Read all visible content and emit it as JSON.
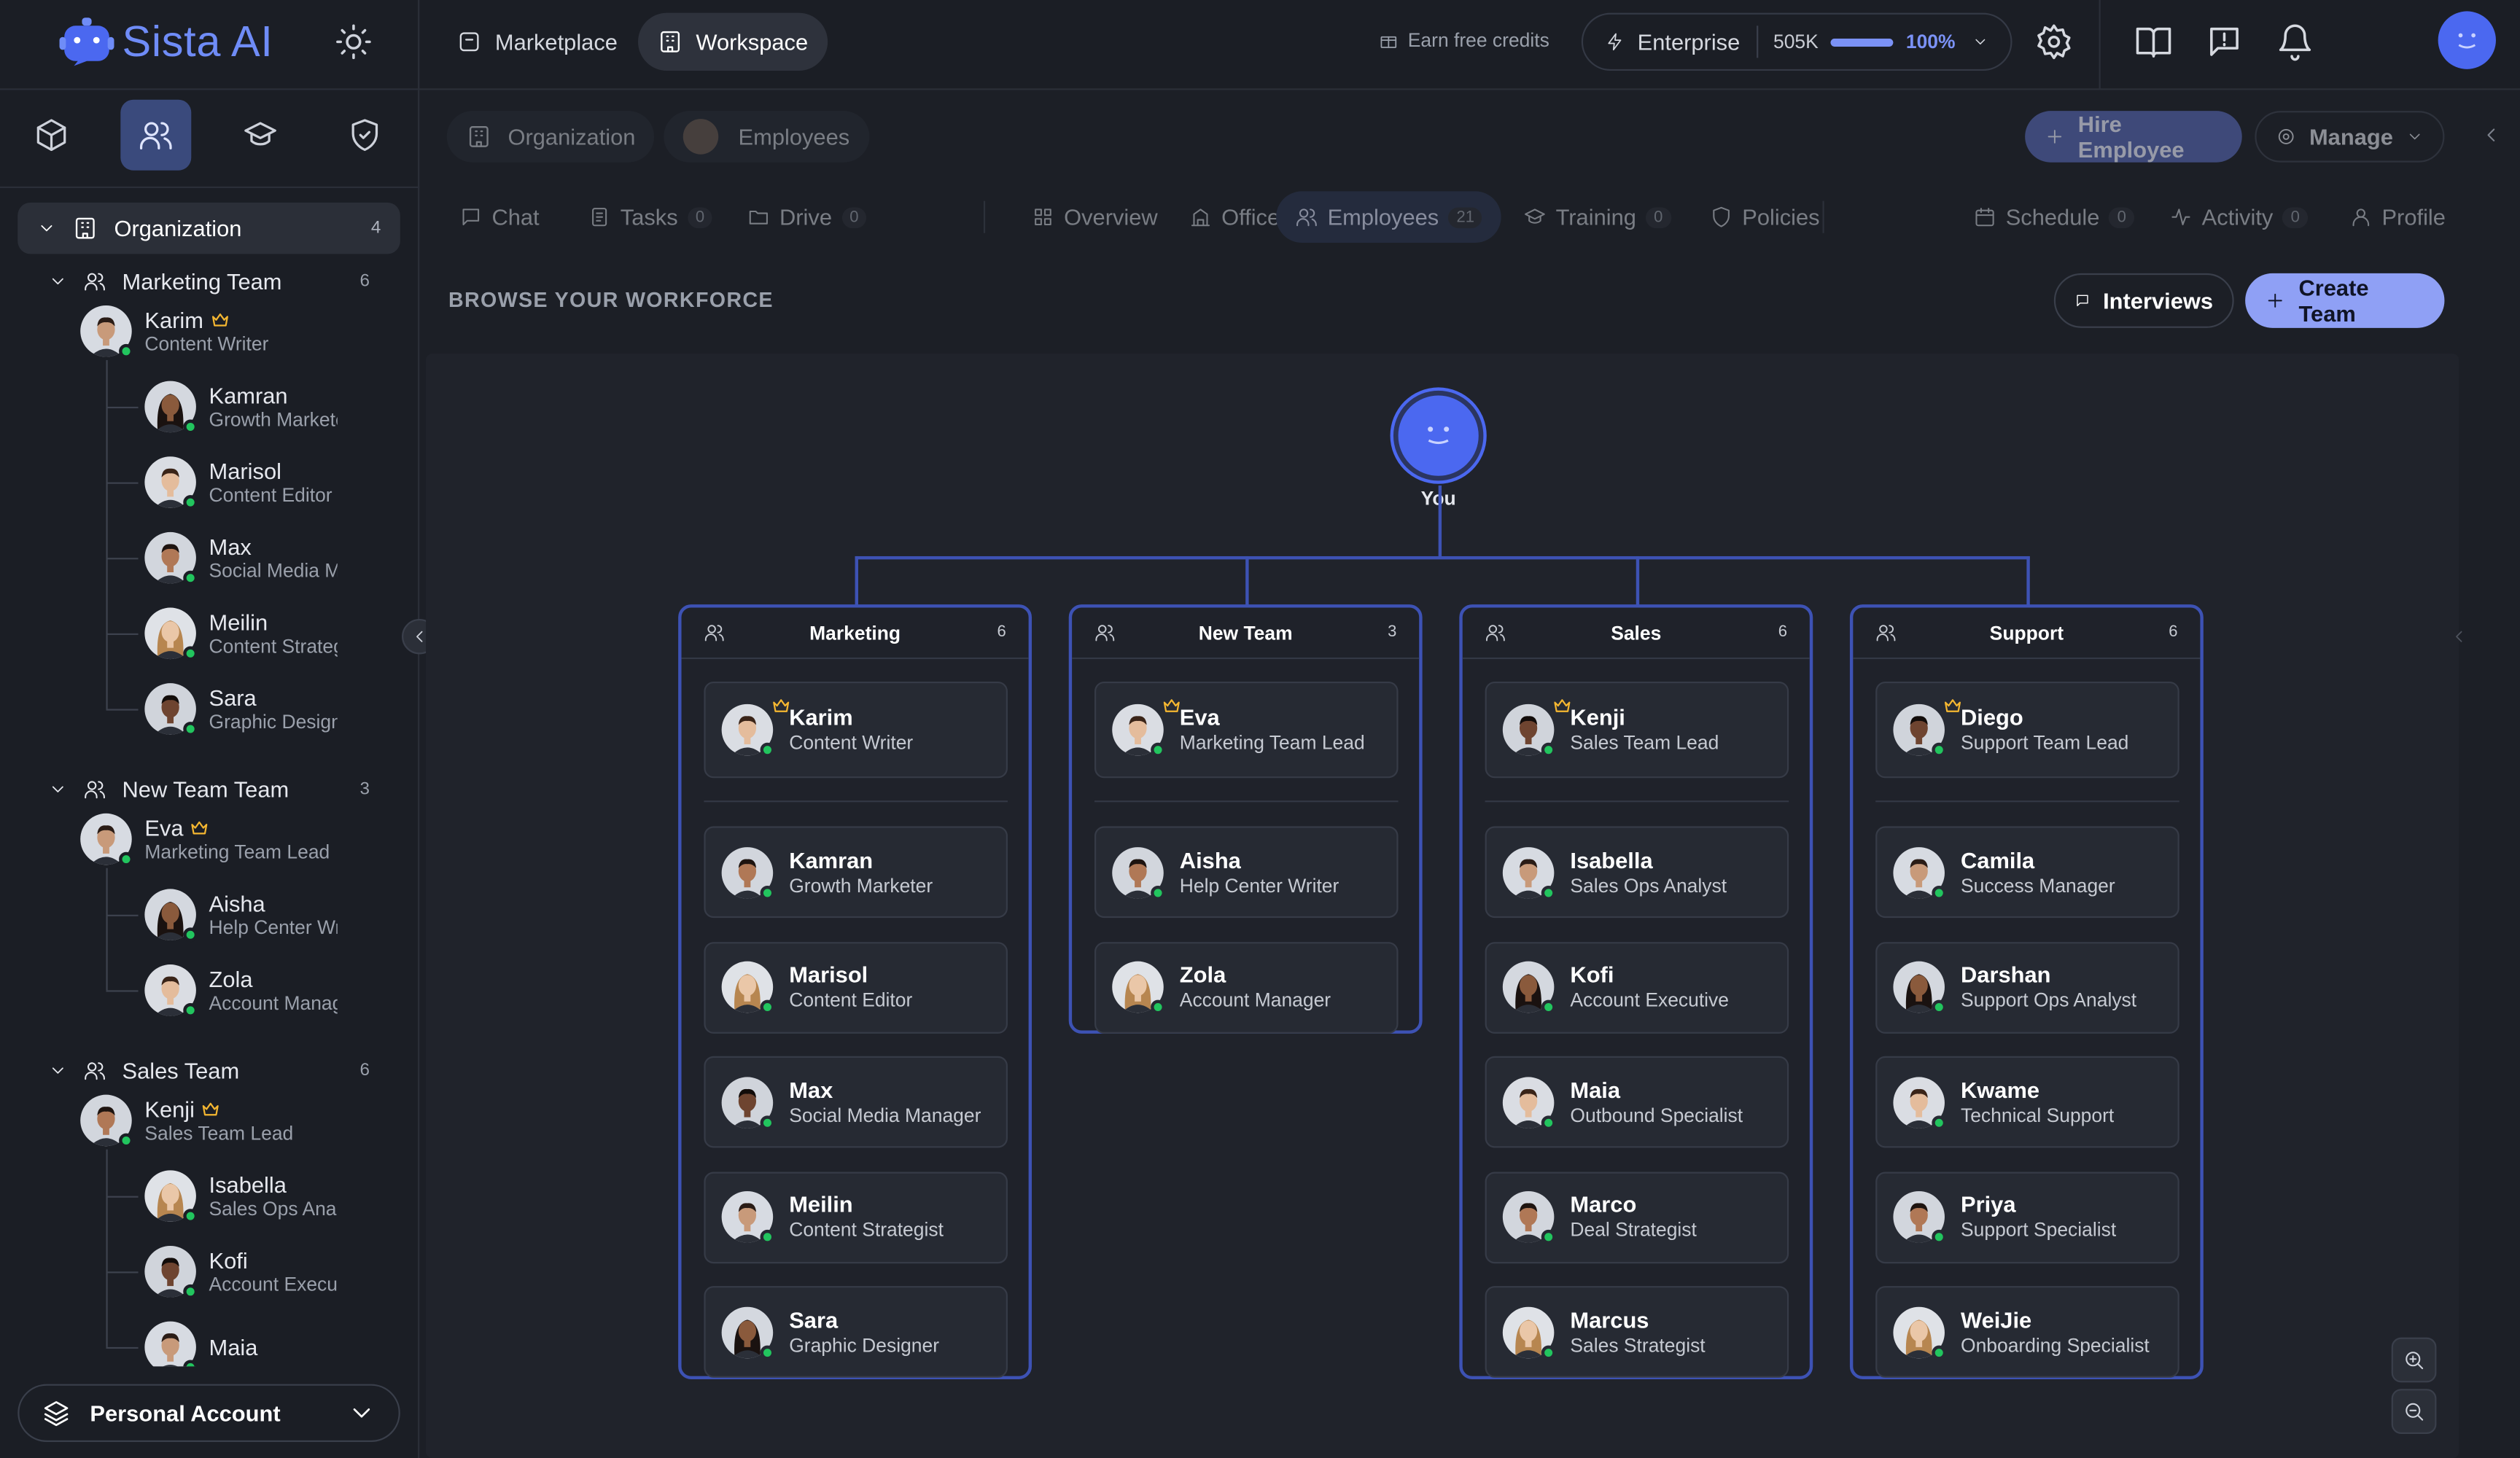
{
  "app": {
    "name": "Sista AI"
  },
  "topbar": {
    "nav": [
      {
        "label": "Marketplace",
        "icon": "store-icon",
        "active": false
      },
      {
        "label": "Workspace",
        "icon": "building-icon",
        "active": true
      }
    ],
    "earn_credits": "Earn free credits",
    "plan": {
      "name": "Enterprise",
      "credits": "505K",
      "usage_percent": "100%",
      "usage_fraction": 1.0
    },
    "icons": [
      "settings-icon",
      "book-icon",
      "feedback-icon",
      "bell-icon"
    ]
  },
  "sidebar": {
    "tabs": [
      {
        "icon": "cube-icon",
        "active": false
      },
      {
        "icon": "users-icon",
        "active": true
      },
      {
        "icon": "graduation-cap-icon",
        "active": false
      },
      {
        "icon": "shield-icon",
        "active": false
      }
    ],
    "org": {
      "label": "Organization",
      "count": "4"
    },
    "teams": [
      {
        "label": "Marketing Team",
        "count": "6",
        "lead": {
          "name": "Karim",
          "role": "Content Writer"
        },
        "members": [
          {
            "name": "Kamran",
            "role": "Growth Marketer"
          },
          {
            "name": "Marisol",
            "role": "Content Editor"
          },
          {
            "name": "Max",
            "role": "Social Media Manager"
          },
          {
            "name": "Meilin",
            "role": "Content Strategist"
          },
          {
            "name": "Sara",
            "role": "Graphic Designer"
          }
        ]
      },
      {
        "label": "New Team Team",
        "count": "3",
        "lead": {
          "name": "Eva",
          "role": "Marketing Team Lead"
        },
        "members": [
          {
            "name": "Aisha",
            "role": "Help Center Writer"
          },
          {
            "name": "Zola",
            "role": "Account Manager"
          }
        ]
      },
      {
        "label": "Sales Team",
        "count": "6",
        "lead": {
          "name": "Kenji",
          "role": "Sales Team Lead"
        },
        "members": [
          {
            "name": "Isabella",
            "role": "Sales Ops Analyst"
          },
          {
            "name": "Kofi",
            "role": "Account Executive"
          },
          {
            "name": "Maia",
            "role": ""
          }
        ]
      }
    ],
    "personal_account": "Personal Account"
  },
  "main": {
    "crumbs": [
      {
        "label": "Organization"
      },
      {
        "label": "Employees"
      }
    ],
    "hire_button": "Hire Employee",
    "manage_button": "Manage",
    "tabs": [
      {
        "label": "Chat",
        "icon": "chat-icon",
        "badge": ""
      },
      {
        "label": "Tasks",
        "icon": "tasks-icon",
        "badge": "0"
      },
      {
        "label": "Drive",
        "icon": "folder-icon",
        "badge": "0"
      },
      {
        "label": "Overview",
        "icon": "grid-icon",
        "badge": ""
      },
      {
        "label": "Office",
        "icon": "office-icon",
        "badge": ""
      },
      {
        "label": "Employees",
        "icon": "users-icon",
        "badge": "21"
      },
      {
        "label": "Training",
        "icon": "graduation-cap-icon",
        "badge": "0"
      },
      {
        "label": "Policies",
        "icon": "shield-icon",
        "badge": ""
      },
      {
        "label": "Schedule",
        "icon": "calendar-icon",
        "badge": "0"
      },
      {
        "label": "Activity",
        "icon": "activity-icon",
        "badge": "0"
      },
      {
        "label": "Profile",
        "icon": "user-icon",
        "badge": ""
      }
    ],
    "browse_title": "BROWSE YOUR WORKFORCE",
    "interviews_button": "Interviews",
    "create_team_button": "Create Team",
    "org_chart": {
      "root_label": "You",
      "teams": [
        {
          "name": "Marketing",
          "count": "6",
          "lead": {
            "name": "Karim",
            "role": "Content Writer"
          },
          "members": [
            {
              "name": "Kamran",
              "role": "Growth Marketer"
            },
            {
              "name": "Marisol",
              "role": "Content Editor"
            },
            {
              "name": "Max",
              "role": "Social Media Manager"
            },
            {
              "name": "Meilin",
              "role": "Content Strategist"
            },
            {
              "name": "Sara",
              "role": "Graphic Designer"
            }
          ]
        },
        {
          "name": "New Team",
          "count": "3",
          "lead": {
            "name": "Eva",
            "role": "Marketing Team Lead"
          },
          "members": [
            {
              "name": "Aisha",
              "role": "Help Center Writer"
            },
            {
              "name": "Zola",
              "role": "Account Manager"
            }
          ]
        },
        {
          "name": "Sales",
          "count": "6",
          "lead": {
            "name": "Kenji",
            "role": "Sales Team Lead"
          },
          "members": [
            {
              "name": "Isabella",
              "role": "Sales Ops Analyst"
            },
            {
              "name": "Kofi",
              "role": "Account Executive"
            },
            {
              "name": "Maia",
              "role": "Outbound Specialist"
            },
            {
              "name": "Marco",
              "role": "Deal Strategist"
            },
            {
              "name": "Marcus",
              "role": "Sales Strategist"
            }
          ]
        },
        {
          "name": "Support",
          "count": "6",
          "lead": {
            "name": "Diego",
            "role": "Support Team Lead"
          },
          "members": [
            {
              "name": "Camila",
              "role": "Success Manager"
            },
            {
              "name": "Darshan",
              "role": "Support Ops Analyst"
            },
            {
              "name": "Kwame",
              "role": "Technical Support"
            },
            {
              "name": "Priya",
              "role": "Support Specialist"
            },
            {
              "name": "WeiJie",
              "role": "Onboarding Specialist"
            }
          ]
        }
      ]
    }
  },
  "colors": {
    "accent": "#4b68f0",
    "accent_light": "#8fa0f5",
    "connector": "#3d52b4",
    "online": "#22c55e",
    "crown": "#f5b731"
  }
}
